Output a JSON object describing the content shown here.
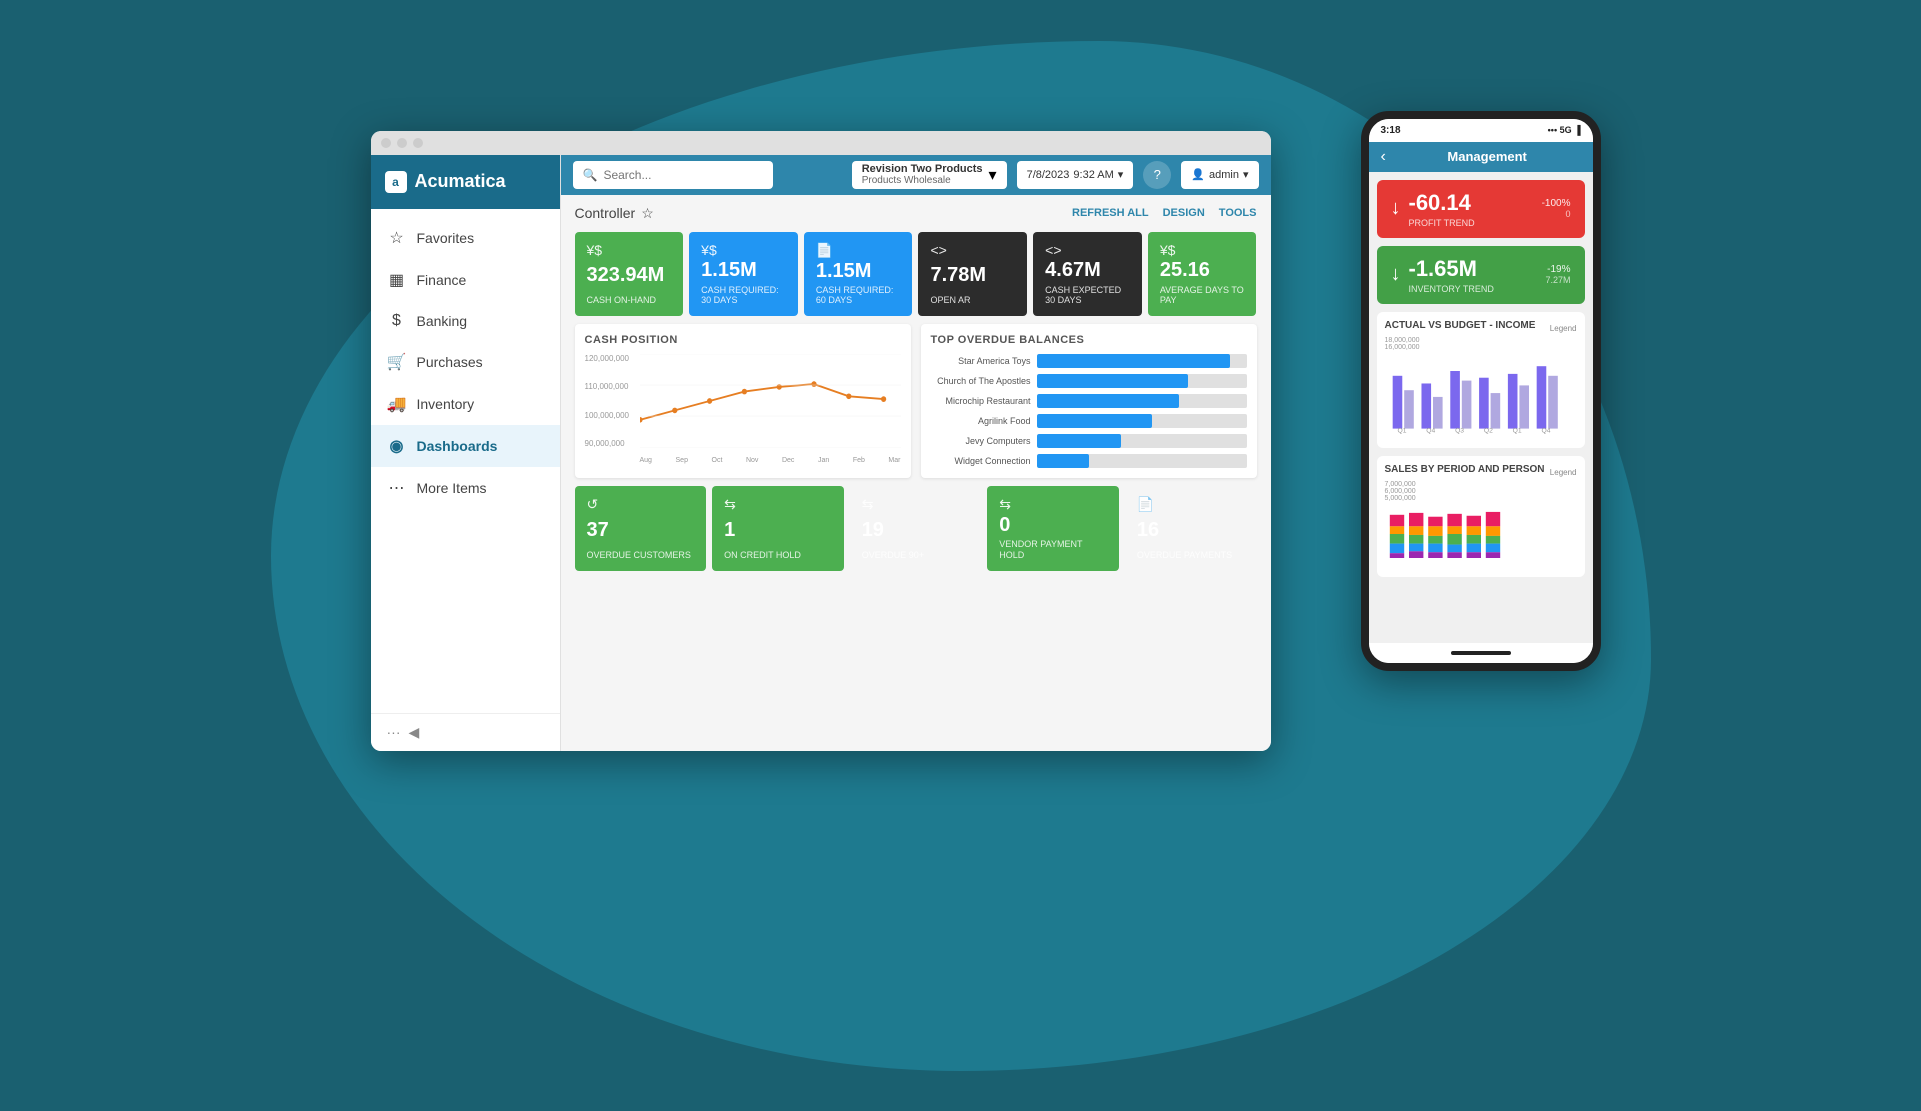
{
  "app": {
    "name": "Acumatica",
    "logo_letter": "a"
  },
  "sidebar": {
    "items": [
      {
        "id": "favorites",
        "label": "Favorites",
        "icon": "☆"
      },
      {
        "id": "finance",
        "label": "Finance",
        "icon": "▦"
      },
      {
        "id": "banking",
        "label": "Banking",
        "icon": "$"
      },
      {
        "id": "purchases",
        "label": "Purchases",
        "icon": "🛒"
      },
      {
        "id": "inventory",
        "label": "Inventory",
        "icon": "🚚"
      },
      {
        "id": "dashboards",
        "label": "Dashboards",
        "icon": "◉",
        "active": true
      },
      {
        "id": "more-items",
        "label": "More Items",
        "icon": "⋯"
      }
    ],
    "collapse_icon": "◀",
    "dots_icon": "···"
  },
  "topbar": {
    "search_placeholder": "Search...",
    "company": {
      "name": "Revision Two Products",
      "sub": "Products Wholesale"
    },
    "date": "7/8/2023",
    "time": "9:32 AM",
    "help_icon": "?",
    "user": "admin"
  },
  "dashboard": {
    "title": "Controller",
    "actions": [
      "REFRESH ALL",
      "DESIGN",
      "TOOLS"
    ],
    "kpi_row1": [
      {
        "value": "323.94M",
        "label": "CASH ON-HAND",
        "icon": "¥$",
        "color": "green"
      },
      {
        "value": "1.15M",
        "label": "CASH REQUIRED: 30 DAYS",
        "icon": "¥$",
        "color": "blue"
      },
      {
        "value": "1.15M",
        "label": "CASH REQUIRED: 60 DAYS",
        "icon": "📄",
        "color": "blue"
      },
      {
        "value": "7.78M",
        "label": "OPEN AR",
        "icon": "<>",
        "color": "dark"
      },
      {
        "value": "4.67M",
        "label": "CASH EXPECTED 30 DAYS",
        "icon": "<>",
        "color": "dark"
      },
      {
        "value": "25.16",
        "label": "AVERAGE DAYS TO PAY",
        "icon": "¥$",
        "color": "green"
      }
    ],
    "overdue": {
      "title": "TOP OVERDUE BALANCES",
      "cards": [
        {
          "value": "37",
          "label": "OVERDUE CUSTOMERS",
          "icon": "↺",
          "color": "green"
        },
        {
          "value": "1",
          "label": "ON CREDIT HOLD",
          "icon": "⇆",
          "color": "green"
        },
        {
          "value": "19",
          "label": "OVERDUE 90+",
          "icon": "⇆",
          "color": "red"
        }
      ],
      "cards2": [
        {
          "value": "0",
          "label": "VENDOR PAYMENT HOLD",
          "icon": "⇆",
          "color": "green"
        },
        {
          "value": "16",
          "label": "OVERDUE PAYMENTS",
          "icon": "📄",
          "color": "red"
        }
      ],
      "bars": [
        {
          "label": "Star America Toys",
          "pct": 92
        },
        {
          "label": "Church of The Apostles",
          "pct": 72
        },
        {
          "label": "Microchip Restaurant",
          "pct": 68
        },
        {
          "label": "Agrilink Food",
          "pct": 55
        },
        {
          "label": "Jevy Computers",
          "pct": 40
        },
        {
          "label": "Widget Connection",
          "pct": 25
        }
      ]
    },
    "cash_position": {
      "title": "CASH POSITION",
      "y_labels": [
        "120,000,000",
        "110,000,000",
        "100,000,000",
        "90,000,000"
      ],
      "x_labels": [
        "Aug",
        "Sep",
        "Oct",
        "Nov",
        "Dec",
        "Jan",
        "Feb",
        "Mar"
      ]
    }
  },
  "phone": {
    "status_time": "3:18",
    "status_signal": "5G◀",
    "nav_title": "Management",
    "kpi1": {
      "value": "-60.14",
      "pct": "-100%",
      "sub": "0",
      "label": "PROFIT TREND",
      "color": "red"
    },
    "kpi2": {
      "value": "-1.65M",
      "pct": "-19%",
      "sub": "7.27M",
      "label": "INVENTORY TREND",
      "color": "green"
    },
    "chart1_title": "ACTUAL VS BUDGET - INCOME",
    "chart1_legend": "Legend",
    "chart1_labels": [
      "Q1",
      "Q4",
      "Q3",
      "Q2",
      "Q1",
      "Q4"
    ],
    "chart1_values1": [
      65,
      50,
      70,
      55,
      60,
      75
    ],
    "chart1_values2": [
      45,
      35,
      55,
      40,
      48,
      58
    ],
    "chart2_title": "SALES BY PERIOD AND PERSON",
    "chart2_legend": "Legend"
  }
}
